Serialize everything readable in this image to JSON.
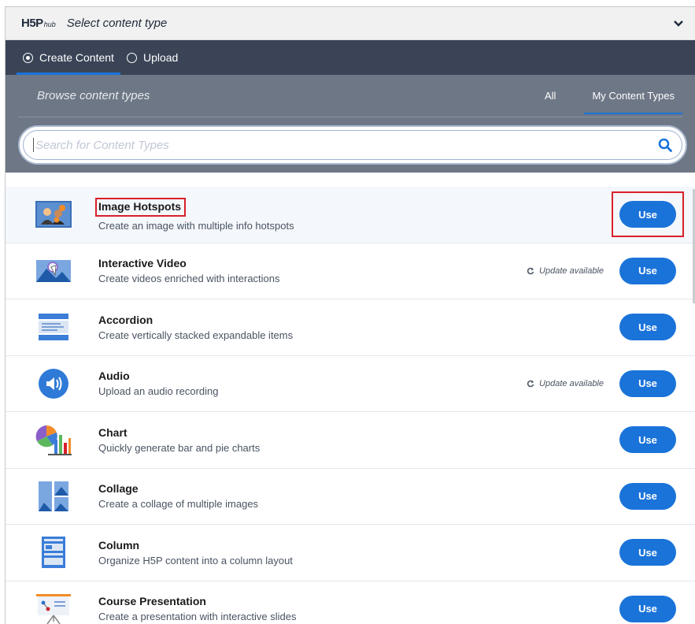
{
  "header": {
    "logo_main": "H5P",
    "logo_sub": "hub",
    "title": "Select content type"
  },
  "tabs": [
    {
      "label": "Create Content",
      "selected": true
    },
    {
      "label": "Upload",
      "selected": false
    }
  ],
  "browse": {
    "title": "Browse content types",
    "filters": [
      "All",
      "My Content Types"
    ],
    "active_filter": "My Content Types"
  },
  "search": {
    "placeholder": "Search for Content Types",
    "value": ""
  },
  "items": [
    {
      "title": "Image Hotspots",
      "description": "Create an image with multiple info hotspots",
      "button": "Use",
      "update": ""
    },
    {
      "title": "Interactive Video",
      "description": "Create videos enriched with interactions",
      "button": "Use",
      "update": "Update available"
    },
    {
      "title": "Accordion",
      "description": "Create vertically stacked expandable items",
      "button": "Use",
      "update": ""
    },
    {
      "title": "Audio",
      "description": "Upload an audio recording",
      "button": "Use",
      "update": "Update available"
    },
    {
      "title": "Chart",
      "description": "Quickly generate bar and pie charts",
      "button": "Use",
      "update": ""
    },
    {
      "title": "Collage",
      "description": "Create a collage of multiple images",
      "button": "Use",
      "update": ""
    },
    {
      "title": "Column",
      "description": "Organize H5P content into a column layout",
      "button": "Use",
      "update": ""
    },
    {
      "title": "Course Presentation",
      "description": "Create a presentation with interactive slides",
      "button": "Use",
      "update": ""
    }
  ],
  "colors": {
    "accent": "#1a73d9",
    "highlight": "#d8202b",
    "tab_bar": "#3a4456",
    "browse_panel": "#6e7786"
  },
  "icons": [
    "chevron-down-icon",
    "search-icon",
    "refresh-icon",
    "image-hotspots-icon",
    "interactive-video-icon",
    "accordion-icon",
    "audio-icon",
    "chart-icon",
    "collage-icon",
    "column-icon",
    "course-presentation-icon"
  ]
}
